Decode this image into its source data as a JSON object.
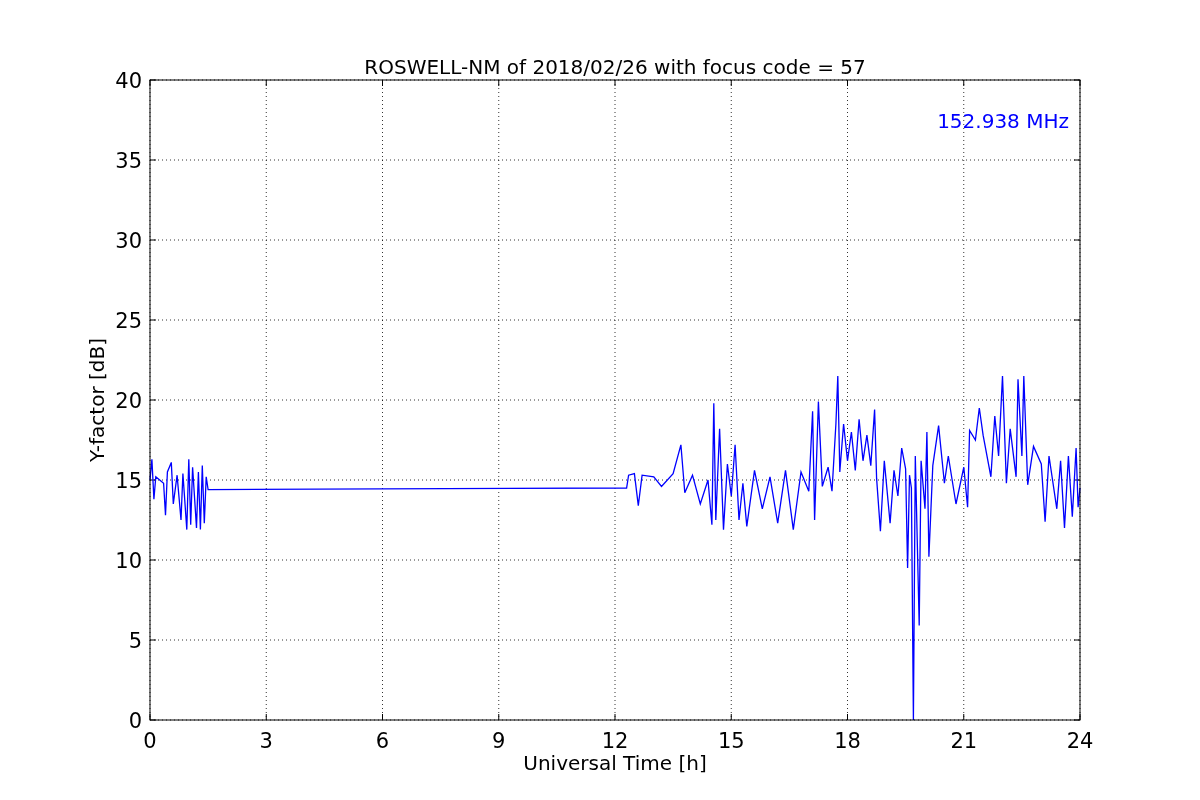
{
  "figure": {
    "chart_data": {
      "type": "line",
      "title": "ROSWELL-NM of 2018/02/26 with focus code = 57",
      "xlabel": "Universal Time [h]",
      "ylabel": "Y-factor [dB]",
      "x": [
        0,
        0.05,
        0.1,
        0.15,
        0.25,
        0.35,
        0.4,
        0.45,
        0.55,
        0.6,
        0.7,
        0.8,
        0.85,
        0.95,
        1.0,
        1.05,
        1.1,
        1.2,
        1.25,
        1.3,
        1.35,
        1.4,
        1.45,
        1.5,
        12.3,
        12.35,
        12.5,
        12.6,
        12.7,
        13,
        13.2,
        13.5,
        13.7,
        13.8,
        14,
        14.2,
        14.4,
        14.5,
        14.55,
        14.6,
        14.7,
        14.8,
        14.9,
        15,
        15.1,
        15.2,
        15.3,
        15.4,
        15.6,
        15.8,
        16,
        16.2,
        16.4,
        16.6,
        16.8,
        17,
        17.1,
        17.15,
        17.25,
        17.35,
        17.5,
        17.6,
        17.7,
        17.75,
        17.8,
        17.9,
        18,
        18.1,
        18.2,
        18.3,
        18.4,
        18.5,
        18.6,
        18.7,
        18.75,
        18.85,
        18.95,
        19.1,
        19.2,
        19.3,
        19.4,
        19.5,
        19.55,
        19.6,
        19.65,
        19.7,
        19.75,
        19.85,
        19.9,
        20,
        20.05,
        20.1,
        20.2,
        20.35,
        20.5,
        20.6,
        20.8,
        21,
        21.1,
        21.15,
        21.3,
        21.4,
        21.5,
        21.7,
        21.8,
        21.9,
        22,
        22.1,
        22.2,
        22.35,
        22.4,
        22.5,
        22.55,
        22.65,
        22.8,
        23,
        23.1,
        23.2,
        23.4,
        23.5,
        23.6,
        23.7,
        23.8,
        23.9,
        23.95,
        24
      ],
      "series": [
        {
          "name": "152.938 MHz",
          "color": "#0000ff",
          "values": [
            15,
            16.3,
            13.8,
            15.2,
            15,
            14.8,
            12.8,
            15.5,
            16.1,
            13.5,
            15.3,
            12.5,
            15.4,
            11.9,
            16.3,
            12.2,
            15.8,
            12,
            15.5,
            11.9,
            15.9,
            12.3,
            15.2,
            14.4,
            14.5,
            15.3,
            15.4,
            13.4,
            15.3,
            15.2,
            14.6,
            15.4,
            17.2,
            14.2,
            15.3,
            13.5,
            15,
            12.2,
            19.8,
            12.5,
            18.2,
            11.9,
            16,
            14,
            17.2,
            12.5,
            14.8,
            12.1,
            15.6,
            13.2,
            15.2,
            12.3,
            15.6,
            11.9,
            15.5,
            14.3,
            19.3,
            12.5,
            19.9,
            14.6,
            15.8,
            14.3,
            18.5,
            21.5,
            15.5,
            18.5,
            16.2,
            18,
            15.6,
            18.8,
            16.2,
            17.8,
            15.9,
            19.4,
            15.1,
            11.8,
            16.2,
            12.3,
            15.6,
            14,
            17,
            15.7,
            9.5,
            15.3,
            14.5,
            0,
            16.5,
            5.9,
            16.2,
            13.2,
            18,
            10.2,
            15.9,
            18.4,
            14.8,
            16.5,
            13.5,
            15.8,
            13.3,
            18.1,
            17.5,
            19.5,
            17.8,
            15.2,
            19,
            16.5,
            21.5,
            14.8,
            18.2,
            15.2,
            21.3,
            16.5,
            21.5,
            14.7,
            17.1,
            16,
            12.4,
            16.5,
            13.2,
            16.2,
            12,
            16.5,
            12.7,
            17,
            13.3,
            14.5
          ]
        }
      ],
      "xlim": [
        0,
        24
      ],
      "ylim": [
        0,
        40
      ],
      "xticks": [
        0,
        3,
        6,
        9,
        12,
        15,
        18,
        21,
        24
      ],
      "yticks": [
        0,
        5,
        10,
        15,
        20,
        25,
        30,
        35,
        40
      ],
      "grid": true
    }
  }
}
